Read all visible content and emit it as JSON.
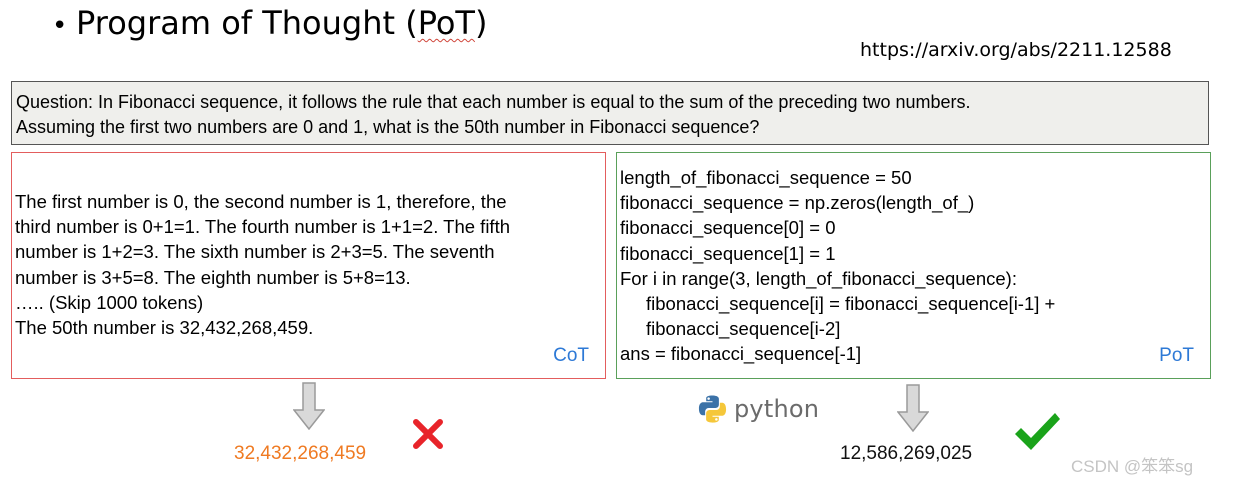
{
  "title": {
    "bullet": "•",
    "text": "Program of Thought (",
    "abbr": "PoT",
    "close": ")"
  },
  "source_url": "https://arxiv.org/abs/2211.12588",
  "question": {
    "lines": [
      "Question: In Fibonacci sequence, it follows the rule that each number is equal to the sum of the preceding two numbers.",
      "Assuming the first two numbers are 0 and 1, what is the 50th number in Fibonacci sequence?"
    ]
  },
  "cot": {
    "lines": [
      "The first number is 0, the second number is 1, therefore, the",
      "third number is 0+1=1. The fourth number is 1+1=2. The fifth",
      "number is 1+2=3. The sixth number is 2+3=5. The seventh",
      "number is 3+5=8. The eighth number is 5+8=13.",
      "….. (Skip 1000 tokens)",
      "The 50th number is 32,432,268,459."
    ],
    "tag": "CoT",
    "answer": "32,432,268,459",
    "result_icon": "cross-mark-icon",
    "result_color": "#e8242a"
  },
  "pot": {
    "lines": [
      "length_of_fibonacci_sequence = 50",
      "fibonacci_sequence = np.zeros(length_of_)",
      "fibonacci_sequence[0] = 0",
      "fibonacci_sequence[1] = 1",
      "For i in range(3, length_of_fibonacci_sequence):",
      "fibonacci_sequence[i] = fibonacci_sequence[i-1] +",
      "fibonacci_sequence[i-2]",
      "ans = fibonacci_sequence[-1]"
    ],
    "tag": "PoT",
    "answer": "12,586,269,025",
    "result_icon": "check-mark-icon",
    "result_color": "#1aa31a",
    "executor_label": "python",
    "executor_icon": "python-logo-icon"
  },
  "watermark": "CSDN @笨笨sg",
  "colors": {
    "cot_border": "#e35d5d",
    "pot_border": "#5aa05a",
    "tag": "#2d79d6",
    "cot_answer": "#ef7a22",
    "question_bg": "#efefec"
  }
}
